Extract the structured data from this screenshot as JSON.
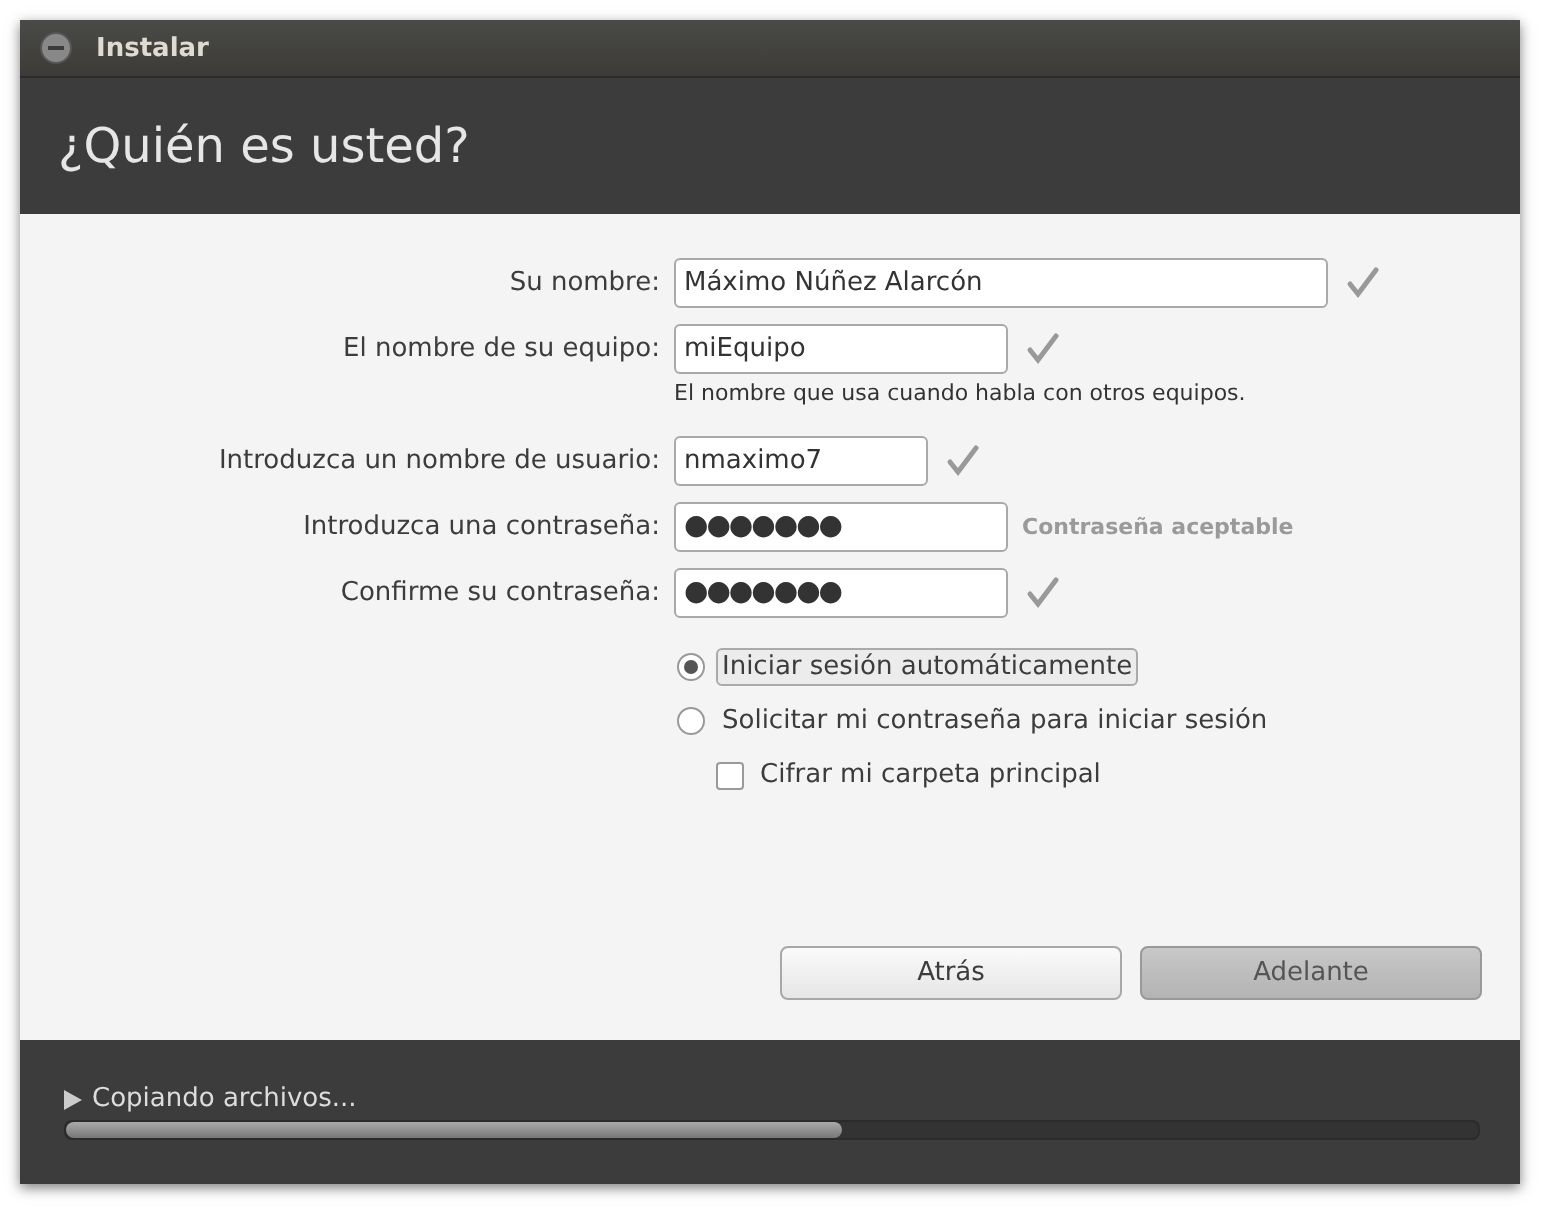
{
  "window": {
    "title": "Instalar"
  },
  "heading": "¿Quién es usted?",
  "fields": [
    {
      "label": "Su nombre:",
      "value": "Máximo Núñez Alarcón",
      "kind": "text",
      "valid": true
    },
    {
      "label": "El nombre de su equipo:",
      "value": "miEquipo",
      "kind": "text",
      "valid": true,
      "hint": "El nombre que usa cuando habla con otros equipos."
    },
    {
      "label": "Introduzca un nombre de usuario:",
      "value": "nmaximo7",
      "kind": "text",
      "valid": true
    },
    {
      "label": "Introduzca una contraseña:",
      "value": "●●●●●●●",
      "kind": "password",
      "valid": false,
      "status": "Contraseña aceptable"
    },
    {
      "label": "Confirme su contraseña:",
      "value": "●●●●●●●",
      "kind": "password",
      "valid": true
    }
  ],
  "login_options": [
    {
      "label": "Iniciar sesión automáticamente",
      "kind": "radio",
      "selected": true
    },
    {
      "label": "Solicitar mi contraseña para iniciar sesión",
      "kind": "radio",
      "selected": false
    },
    {
      "label": "Cifrar mi carpeta principal",
      "kind": "checkbox",
      "checked": false
    }
  ],
  "buttons": [
    {
      "label": "Atrás",
      "disabled": false
    },
    {
      "label": "Adelante",
      "disabled": true
    }
  ],
  "progress": {
    "label": "Copiando archivos...",
    "level": 0.55
  }
}
